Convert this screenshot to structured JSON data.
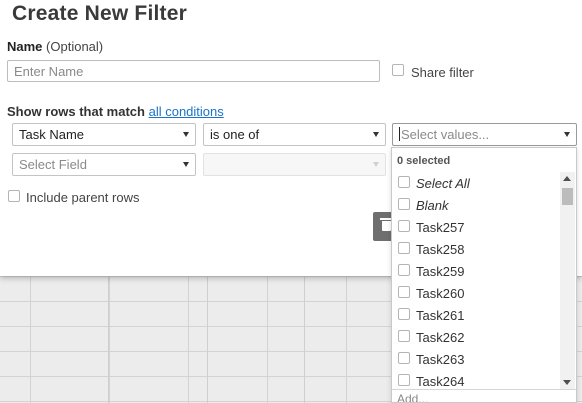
{
  "dialog": {
    "title": "Create New Filter",
    "name_label": "Name",
    "name_optional": "(Optional)",
    "name_placeholder": "Enter Name",
    "share_filter_label": "Share filter",
    "match_prefix": "Show rows that match",
    "match_link": "all conditions",
    "include_parent_label": "Include parent rows"
  },
  "conditions": [
    {
      "field": "Task Name",
      "operator": "is one of",
      "values_placeholder": "Select values..."
    },
    {
      "field_placeholder": "Select Field",
      "operator": ""
    }
  ],
  "values_dropdown": {
    "selected_count_text": "0 selected",
    "items": [
      {
        "label": "Select All",
        "italic": true,
        "checked": false
      },
      {
        "label": "Blank",
        "italic": true,
        "checked": false
      },
      {
        "label": "Task257",
        "italic": false,
        "checked": false
      },
      {
        "label": "Task258",
        "italic": false,
        "checked": false
      },
      {
        "label": "Task259",
        "italic": false,
        "checked": false
      },
      {
        "label": "Task260",
        "italic": false,
        "checked": false
      },
      {
        "label": "Task261",
        "italic": false,
        "checked": false
      },
      {
        "label": "Task262",
        "italic": false,
        "checked": false
      },
      {
        "label": "Task263",
        "italic": false,
        "checked": false
      },
      {
        "label": "Task264",
        "italic": false,
        "checked": false
      }
    ],
    "add_text": "Add..."
  },
  "colors": {
    "link": "#1a73c8",
    "delete_button": "#6f6f6f"
  },
  "icons": {
    "delete": "trash-icon",
    "dropdown": "chevron-down-icon"
  }
}
